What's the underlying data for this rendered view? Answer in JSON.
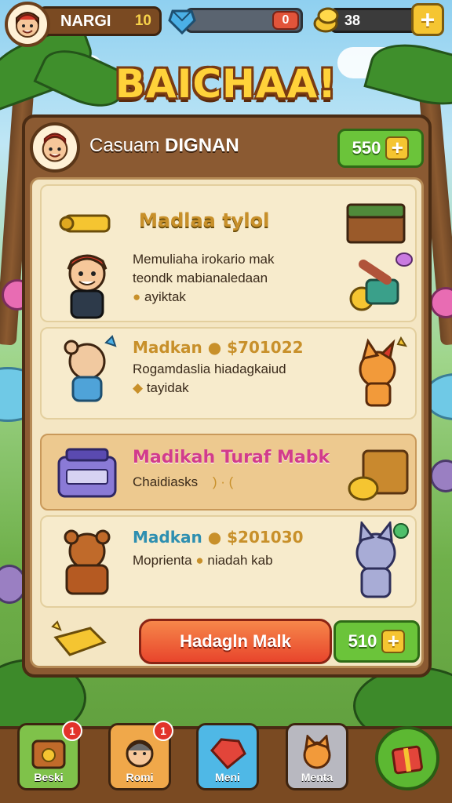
{
  "hud": {
    "player_name": "NARGI",
    "level": "10",
    "gem_button": "0",
    "coins": "38",
    "plus_label": "+"
  },
  "title": "BAICHAA!",
  "panel": {
    "player_name_prefix": "Casuam",
    "player_name_main": "DIGNAN",
    "top_button_value": "550",
    "plus_label": "+"
  },
  "cards": [
    {
      "title": "Madlaa tylol",
      "line1": "Memuliaha irokario mak",
      "line2": "teondk mabianaledaan",
      "line3": "ayiktak"
    },
    {
      "title": "Madkan",
      "price": "$701022",
      "line1": "Rogamdaslia hiadagkaiud",
      "line2": "tayidak"
    },
    {
      "title": "Madikah Turaf Mabk",
      "line1": "Chaidiasks",
      "line1_tail": ") · ("
    },
    {
      "title": "Madkan",
      "price": "$201030",
      "line1": "Moprienta",
      "line1_tail": "niadah kab"
    }
  ],
  "footer": {
    "main_button": "Hadagln Malk",
    "price_button": "510",
    "plus_label": "+"
  },
  "nav": [
    {
      "label": "Beski",
      "badge": "1"
    },
    {
      "label": "Romi",
      "badge": "1"
    },
    {
      "label": "Meni"
    },
    {
      "label": "Menta"
    }
  ],
  "colors": {
    "wood": "#8b5a32",
    "parchment": "#f4e6c3",
    "title_gold": "#ffd23a",
    "green_button": "#6bc43a",
    "red_button": "#e8452c",
    "gold_text": "#c8902a",
    "pink_text": "#d23c8c",
    "teal_text": "#2e8fb0"
  }
}
